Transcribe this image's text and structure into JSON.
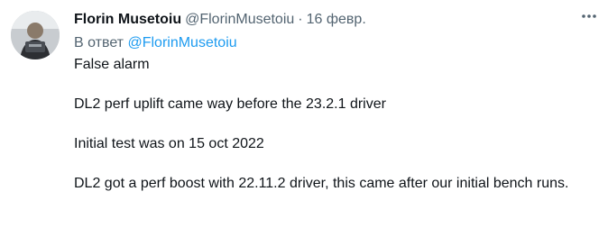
{
  "tweet": {
    "author_name": "Florin Musetoiu",
    "author_handle": "@FlorinMusetoiu",
    "separator": "·",
    "date": "16 февр.",
    "reply_prefix": "В ответ",
    "reply_to": "@FlorinMusetoiu",
    "paragraphs": [
      "False alarm",
      "DL2 perf uplift came way before the 23.2.1 driver",
      "Initial test was on 15 oct 2022",
      "DL2 got a perf boost with 22.11.2 driver, this came after our initial bench runs."
    ]
  },
  "icons": {
    "more": "more-horizontal-icon",
    "avatar": "avatar"
  },
  "colors": {
    "text_primary": "#0f1419",
    "text_secondary": "#536471",
    "link": "#1d9bf0"
  }
}
